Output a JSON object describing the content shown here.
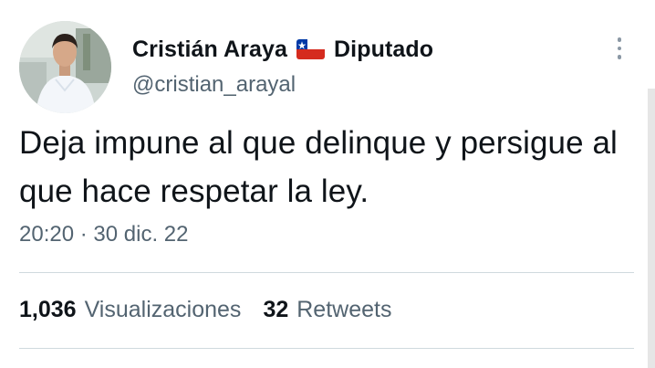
{
  "user": {
    "display_name": "Cristián Araya",
    "flag_icon": "chile-flag-icon",
    "title": "Diputado",
    "handle": "@cristian_arayal"
  },
  "tweet": {
    "text": "Deja impune al que delinque y persigue al que hace respetar la ley.",
    "time": "20:20",
    "separator": "·",
    "date": "30 dic. 22"
  },
  "stats": {
    "views_count": "1,036",
    "views_label": "Visualizaciones",
    "retweets_count": "32",
    "retweets_label": "Retweets"
  },
  "colors": {
    "text_primary": "#0f1419",
    "text_secondary": "#536471",
    "divider": "#cfd9de"
  },
  "icons": {
    "more": "more-options-icon"
  }
}
